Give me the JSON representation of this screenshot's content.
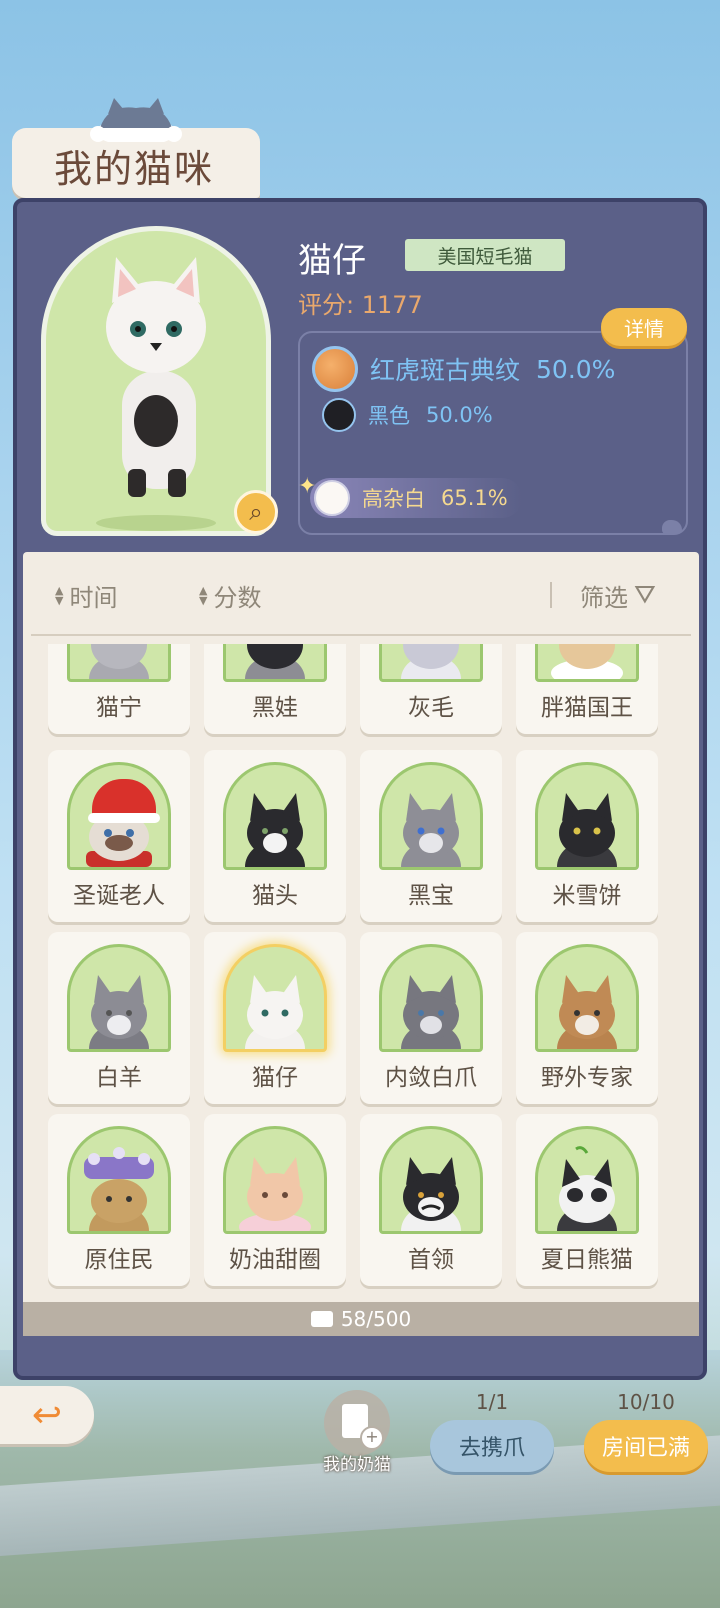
{
  "header": {
    "title": "我的猫咪"
  },
  "current_cat": {
    "name": "猫仔",
    "breed": "美国短毛猫",
    "score_label": "评分: 1177",
    "detail_button": "详情",
    "genes": [
      {
        "name": "红虎斑古典纹",
        "percent": "50.0%",
        "color": "#e0904a"
      },
      {
        "name": "黑色",
        "percent": "50.0%",
        "color": "#1f1f24"
      },
      {
        "name": "高杂白",
        "percent": "65.1%",
        "color": "#fbf8f4"
      }
    ]
  },
  "sort_bar": {
    "time": "时间",
    "score": "分数",
    "filter": "筛选"
  },
  "cats": [
    {
      "name": "猫宁"
    },
    {
      "name": "黑娃"
    },
    {
      "name": "灰毛"
    },
    {
      "name": "胖猫国王"
    },
    {
      "name": "圣诞老人"
    },
    {
      "name": "猫头"
    },
    {
      "name": "黑宝"
    },
    {
      "name": "米雪饼"
    },
    {
      "name": "白羊"
    },
    {
      "name": "猫仔",
      "selected": true
    },
    {
      "name": "内敛白爪"
    },
    {
      "name": "野外专家"
    },
    {
      "name": "原住民"
    },
    {
      "name": "奶油甜圈"
    },
    {
      "name": "首领"
    },
    {
      "name": "夏日熊猫"
    }
  ],
  "capacity": {
    "text": "58/500"
  },
  "footer": {
    "my_milk_cat": "我的奶猫",
    "go_paw": {
      "count": "1/1",
      "label": "去携爪"
    },
    "room": {
      "count": "10/10",
      "label": "房间已满"
    }
  },
  "colors": {
    "accent": "#f3bd4d",
    "panel": "#5b6088",
    "gene_text": "#7fc3f4"
  }
}
